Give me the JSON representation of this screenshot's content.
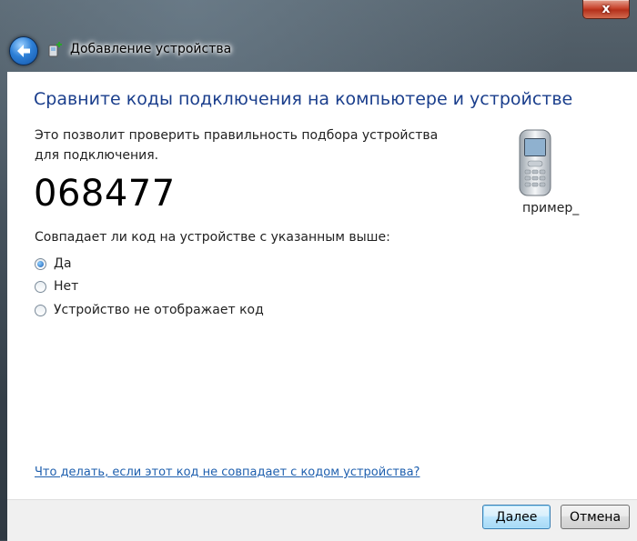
{
  "window": {
    "title": "Добавление устройства",
    "close_label": "x"
  },
  "main": {
    "heading": "Сравните коды подключения на компьютере и устройстве",
    "description": "Это позволит проверить правильность подбора устройства для подключения.",
    "code": "068477",
    "question": "Совпадает ли код на устройстве с указанным выше:",
    "options": [
      {
        "label": "Да",
        "selected": true
      },
      {
        "label": "Нет",
        "selected": false
      },
      {
        "label": "Устройство не отображает код",
        "selected": false
      }
    ],
    "device_name": "пример_",
    "help_link": "Что делать, если этот код не совпадает с кодом устройства?"
  },
  "buttons": {
    "next": "Далее",
    "cancel": "Отмена"
  }
}
